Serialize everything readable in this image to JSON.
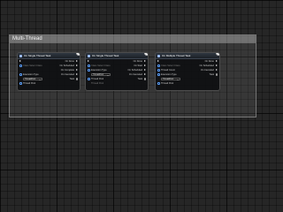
{
  "comment": {
    "title": "Multi-Thread"
  },
  "nodes": [
    {
      "title": "On Single Thread Task",
      "rows": [
        {
          "left": "",
          "right": "On Done"
        },
        {
          "left": "Class  Select Class",
          "right": "On Scheduled"
        },
        {
          "left": "",
          "right": "On Complete"
        },
        {
          "left": "Execution Type",
          "right": "On Canceled"
        },
        {
          "left": "Thread Pool",
          "right": "Task"
        },
        {
          "left": "Thread Pool",
          "right": ""
        }
      ],
      "dropdown": "ThreadPool"
    },
    {
      "title": "On Single Thread Task",
      "rows": [
        {
          "left": "",
          "right": "On Done"
        },
        {
          "left": "Class  Select Class",
          "right": "On Start"
        },
        {
          "left": "Execution Type",
          "right": "On Scheduled"
        },
        {
          "left": "",
          "right": "On Canceled"
        },
        {
          "left": "Thread Pool",
          "right": "Task"
        },
        {
          "left": "Thread Pool",
          "right": ""
        }
      ],
      "dropdown": "ThreadPool"
    },
    {
      "title": "On Multiple Thread Task",
      "rows": [
        {
          "left": "",
          "right": "On Done"
        },
        {
          "left": "Class  Select Class",
          "right": "On Scheduled"
        },
        {
          "left": "Thread Count",
          "right": "On Canceled"
        },
        {
          "left": "Execution Type",
          "right": "Task"
        },
        {
          "left": "",
          "right": ""
        },
        {
          "left": "Thread Pool",
          "right": ""
        }
      ],
      "dropdown": "ThreadPool"
    }
  ]
}
